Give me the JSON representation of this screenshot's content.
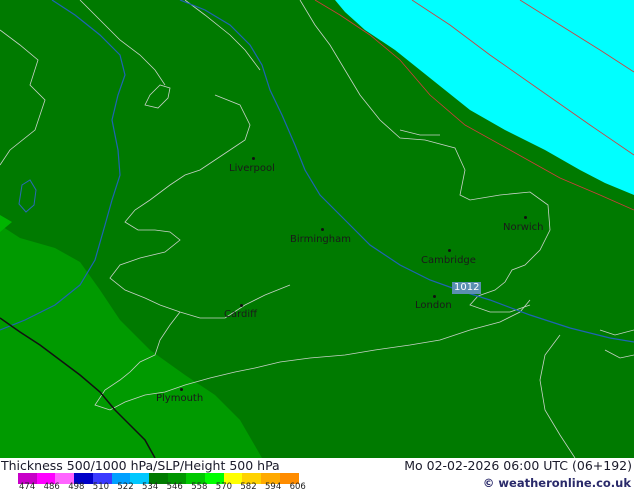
{
  "map": {
    "colors": {
      "sea_low": "#00ffff",
      "thickness_546": "#007a00",
      "thickness_540": "#009a00",
      "thickness_534": "#00b400"
    },
    "cities": [
      {
        "name": "Liverpool",
        "key": "liverpool"
      },
      {
        "name": "Birmingham",
        "key": "birmingham"
      },
      {
        "name": "Norwich",
        "key": "norwich"
      },
      {
        "name": "Cambridge",
        "key": "cambridge"
      },
      {
        "name": "London",
        "key": "london"
      },
      {
        "name": "Cardiff",
        "key": "cardiff"
      },
      {
        "name": "Plymouth",
        "key": "plymouth"
      }
    ],
    "isobar_label": "1012"
  },
  "footer": {
    "title": "Thickness 500/1000 hPa/SLP/Height 500 hPa",
    "datetime": "Mo 02-02-2026 06:00 UTC (06+192)",
    "credit": "© weatheronline.co.uk"
  },
  "legend": {
    "ticks": [
      "474",
      "486",
      "498",
      "510",
      "522",
      "534",
      "546",
      "558",
      "570",
      "582",
      "594",
      "606"
    ],
    "colors": [
      "#c800c8",
      "#ff00ff",
      "#ff64ff",
      "#0000c8",
      "#3a3aff",
      "#00a0ff",
      "#00c8ff",
      "#007a00",
      "#009600",
      "#00c800",
      "#00ff00",
      "#ffff00",
      "#ffd200",
      "#ffaa00",
      "#ff8c00"
    ]
  }
}
